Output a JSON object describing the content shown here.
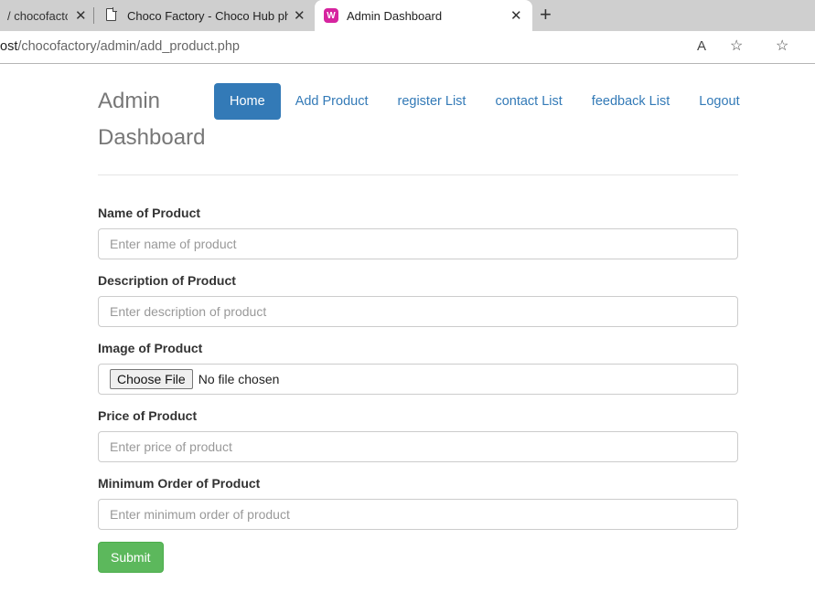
{
  "browser": {
    "tabs": [
      {
        "title": "/ chocofactory"
      },
      {
        "title": "Choco Factory - Choco Hub php"
      },
      {
        "title": "Admin Dashboard"
      }
    ],
    "close_glyph": "✕",
    "new_tab_glyph": "+",
    "url_prefix": "ost",
    "url_path": "/chocofactory/admin/add_product.php",
    "favicon_letter": "W",
    "read_aloud_glyph": "A",
    "add_favorite_glyph": "☆",
    "favorites_glyph": "☆"
  },
  "header": {
    "brand": "Admin Dashboard",
    "nav": [
      {
        "label": "Home",
        "active": true
      },
      {
        "label": "Add Product"
      },
      {
        "label": "register List"
      },
      {
        "label": "contact List"
      },
      {
        "label": "feedback List"
      },
      {
        "label": "Logout"
      }
    ]
  },
  "form": {
    "fields": [
      {
        "label": "Name of Product",
        "placeholder": "Enter name of product"
      },
      {
        "label": "Description of Product",
        "placeholder": "Enter description of product"
      },
      {
        "label": "Image of Product",
        "button": "Choose File",
        "status": "No file chosen"
      },
      {
        "label": "Price of Product",
        "placeholder": "Enter price of product"
      },
      {
        "label": "Minimum Order of Product",
        "placeholder": "Enter minimum order of product"
      }
    ],
    "submit_label": "Submit"
  },
  "colors": {
    "primary": "#337ab7",
    "success": "#5cb85c",
    "brand_text": "#777777",
    "favicon": "#d6249f"
  }
}
